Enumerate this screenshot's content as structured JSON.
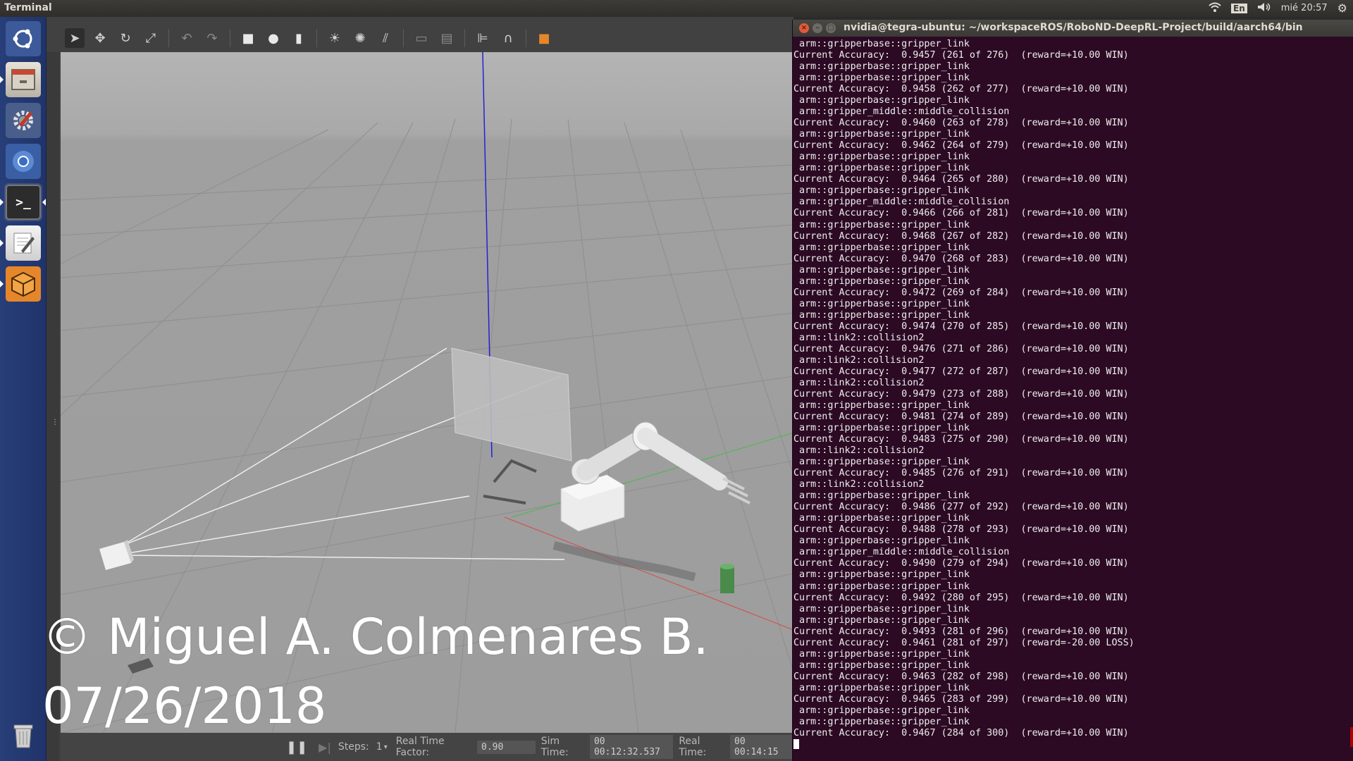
{
  "top_panel": {
    "app_name": "Terminal",
    "keyboard_layout": "En",
    "clock": "mié 20:57"
  },
  "launcher": {
    "items": [
      {
        "name": "dash-home",
        "icon": "ubuntu-logo-icon"
      },
      {
        "name": "files",
        "icon": "file-cabinet-icon"
      },
      {
        "name": "system-settings",
        "icon": "gear-wrench-icon"
      },
      {
        "name": "chromium",
        "icon": "chromium-icon"
      },
      {
        "name": "terminal",
        "icon": "terminal-icon"
      },
      {
        "name": "text-editor",
        "icon": "text-editor-icon"
      },
      {
        "name": "gazebo",
        "icon": "gazebo-icon"
      },
      {
        "name": "trash",
        "icon": "trash-icon"
      }
    ]
  },
  "gazebo": {
    "toolbar": [
      {
        "name": "select-mode",
        "icon": "arrow-cursor-icon",
        "glyph": "➤"
      },
      {
        "name": "translate-mode",
        "icon": "move-arrows-icon",
        "glyph": "✥"
      },
      {
        "name": "rotate-mode",
        "icon": "rotate-icon",
        "glyph": "↻"
      },
      {
        "name": "scale-mode",
        "icon": "scale-icon",
        "glyph": "⤢"
      },
      {
        "name": "undo",
        "icon": "undo-icon",
        "glyph": "↶"
      },
      {
        "name": "redo",
        "icon": "redo-icon",
        "glyph": "↷"
      },
      {
        "name": "box-shape",
        "icon": "box-icon",
        "glyph": "■"
      },
      {
        "name": "sphere-shape",
        "icon": "sphere-icon",
        "glyph": "●"
      },
      {
        "name": "cylinder-shape",
        "icon": "cylinder-icon",
        "glyph": "▮"
      },
      {
        "name": "point-light",
        "icon": "sun-icon",
        "glyph": "☀"
      },
      {
        "name": "spot-light",
        "icon": "spot-light-icon",
        "glyph": "✺"
      },
      {
        "name": "directional-light",
        "icon": "directional-light-icon",
        "glyph": "⫽"
      },
      {
        "name": "copy",
        "icon": "copy-icon",
        "glyph": "▭"
      },
      {
        "name": "paste",
        "icon": "paste-icon",
        "glyph": "▤"
      },
      {
        "name": "align",
        "icon": "align-icon",
        "glyph": "⊫"
      },
      {
        "name": "snap",
        "icon": "magnet-icon",
        "glyph": "∩"
      },
      {
        "name": "view-angle",
        "icon": "view-cube-icon",
        "glyph": "■"
      }
    ],
    "bottom_bar": {
      "steps_label": "Steps:",
      "steps_value": "1",
      "rtf_label": "Real Time Factor:",
      "rtf_value": "0.90",
      "sim_time_label": "Sim Time:",
      "sim_time_value": "00 00:12:32.537",
      "real_time_label": "Real Time:",
      "real_time_value": "00 00:14:15"
    }
  },
  "watermark": {
    "line1": "© Miguel A. Colmenares B.",
    "line2": "07/26/2018"
  },
  "terminal": {
    "title": "nvidia@tegra-ubuntu: ~/workspaceROS/RoboND-DeepRL-Project/build/aarch64/bin",
    "lines": [
      " arm::gripperbase::gripper_link",
      "Current Accuracy:  0.9457 (261 of 276)  (reward=+10.00 WIN)",
      " arm::gripperbase::gripper_link",
      " arm::gripperbase::gripper_link",
      "Current Accuracy:  0.9458 (262 of 277)  (reward=+10.00 WIN)",
      " arm::gripperbase::gripper_link",
      " arm::gripper_middle::middle_collision",
      "Current Accuracy:  0.9460 (263 of 278)  (reward=+10.00 WIN)",
      " arm::gripperbase::gripper_link",
      "Current Accuracy:  0.9462 (264 of 279)  (reward=+10.00 WIN)",
      " arm::gripperbase::gripper_link",
      " arm::gripperbase::gripper_link",
      "Current Accuracy:  0.9464 (265 of 280)  (reward=+10.00 WIN)",
      " arm::gripperbase::gripper_link",
      " arm::gripper_middle::middle_collision",
      "Current Accuracy:  0.9466 (266 of 281)  (reward=+10.00 WIN)",
      " arm::gripperbase::gripper_link",
      "Current Accuracy:  0.9468 (267 of 282)  (reward=+10.00 WIN)",
      " arm::gripperbase::gripper_link",
      "Current Accuracy:  0.9470 (268 of 283)  (reward=+10.00 WIN)",
      " arm::gripperbase::gripper_link",
      " arm::gripperbase::gripper_link",
      "Current Accuracy:  0.9472 (269 of 284)  (reward=+10.00 WIN)",
      " arm::gripperbase::gripper_link",
      " arm::gripperbase::gripper_link",
      "Current Accuracy:  0.9474 (270 of 285)  (reward=+10.00 WIN)",
      " arm::link2::collision2",
      "Current Accuracy:  0.9476 (271 of 286)  (reward=+10.00 WIN)",
      " arm::link2::collision2",
      "Current Accuracy:  0.9477 (272 of 287)  (reward=+10.00 WIN)",
      " arm::link2::collision2",
      "Current Accuracy:  0.9479 (273 of 288)  (reward=+10.00 WIN)",
      " arm::gripperbase::gripper_link",
      "Current Accuracy:  0.9481 (274 of 289)  (reward=+10.00 WIN)",
      " arm::gripperbase::gripper_link",
      "Current Accuracy:  0.9483 (275 of 290)  (reward=+10.00 WIN)",
      " arm::link2::collision2",
      " arm::gripperbase::gripper_link",
      "Current Accuracy:  0.9485 (276 of 291)  (reward=+10.00 WIN)",
      " arm::link2::collision2",
      " arm::gripperbase::gripper_link",
      "Current Accuracy:  0.9486 (277 of 292)  (reward=+10.00 WIN)",
      " arm::gripperbase::gripper_link",
      "Current Accuracy:  0.9488 (278 of 293)  (reward=+10.00 WIN)",
      " arm::gripperbase::gripper_link",
      " arm::gripper_middle::middle_collision",
      "Current Accuracy:  0.9490 (279 of 294)  (reward=+10.00 WIN)",
      " arm::gripperbase::gripper_link",
      " arm::gripperbase::gripper_link",
      "Current Accuracy:  0.9492 (280 of 295)  (reward=+10.00 WIN)",
      " arm::gripperbase::gripper_link",
      " arm::gripperbase::gripper_link",
      "Current Accuracy:  0.9493 (281 of 296)  (reward=+10.00 WIN)",
      "Current Accuracy:  0.9461 (281 of 297)  (reward=-20.00 LOSS)",
      " arm::gripperbase::gripper_link",
      " arm::gripperbase::gripper_link",
      "Current Accuracy:  0.9463 (282 of 298)  (reward=+10.00 WIN)",
      " arm::gripperbase::gripper_link",
      "Current Accuracy:  0.9465 (283 of 299)  (reward=+10.00 WIN)",
      " arm::gripperbase::gripper_link",
      " arm::gripperbase::gripper_link",
      "Current Accuracy:  0.9467 (284 of 300)  (reward=+10.00 WIN)"
    ]
  },
  "colors": {
    "launcher": "#283e78",
    "terminal_bg": "#2c0a24",
    "terminal_fg": "#eeeeec",
    "gazebo_bg": "#414141",
    "accent_orange": "#e6862b"
  }
}
